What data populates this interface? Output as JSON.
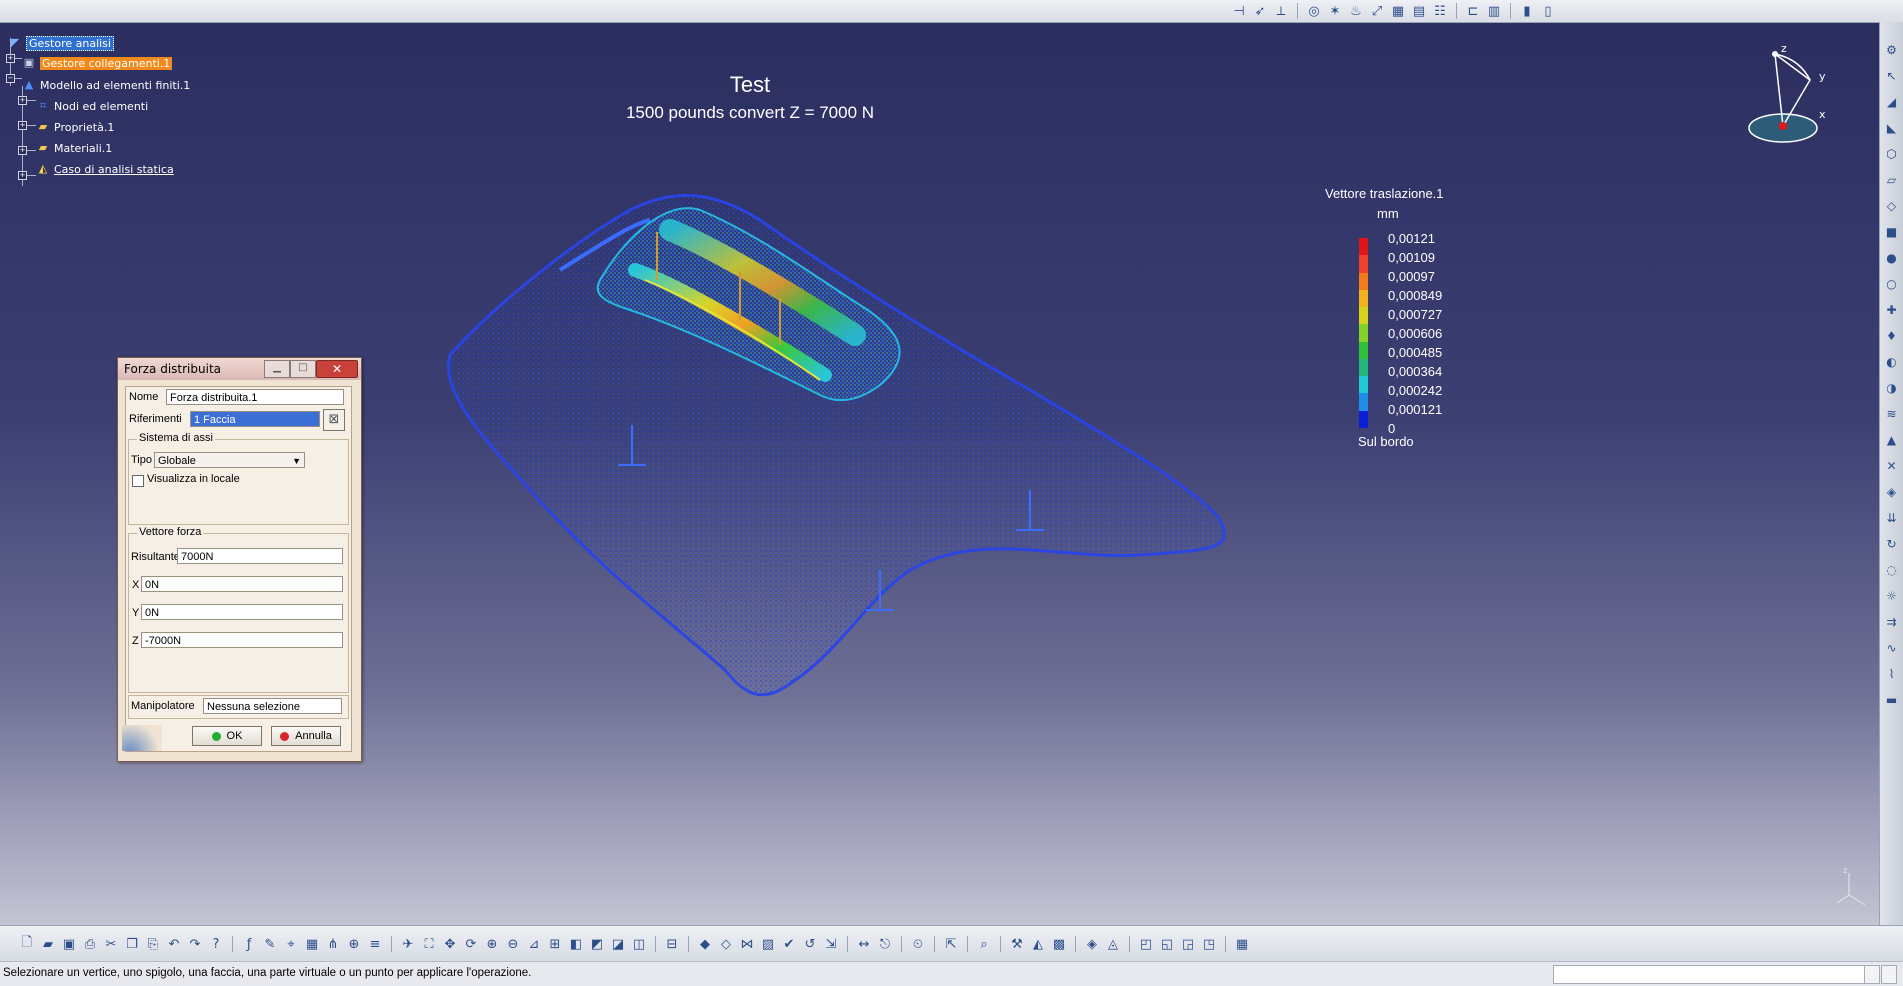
{
  "tree": {
    "items": [
      {
        "label": "Gestore analisi",
        "icon": "analysis-manager-icon"
      },
      {
        "label": "Gestore collegamenti.1",
        "icon": "links-manager-icon"
      },
      {
        "label": "Modello ad elementi finiti.1",
        "icon": "fem-model-icon"
      },
      {
        "label": "Nodi ed elementi",
        "icon": "nodes-elements-icon"
      },
      {
        "label": "Proprietà.1",
        "icon": "folder-icon"
      },
      {
        "label": "Materiali.1",
        "icon": "folder-icon"
      },
      {
        "label": "Caso di analisi statica",
        "icon": "static-case-icon"
      }
    ]
  },
  "viewer": {
    "title": "Test",
    "subtitle": "1500 pounds convert Z = 7000 N"
  },
  "legend": {
    "title": "Vettore traslazione.1",
    "unit": "mm",
    "values": [
      "0,00121",
      "0,00109",
      "0,00097",
      "0,000849",
      "0,000727",
      "0,000606",
      "0,000485",
      "0,000364",
      "0,000242",
      "0,000121",
      "0"
    ],
    "colors": [
      "#e0151a",
      "#f0402a",
      "#f57a1c",
      "#f3b11b",
      "#d7d21b",
      "#84d22a",
      "#2dc23a",
      "#23b77c",
      "#22c9d5",
      "#1e8ee8",
      "#0a1ed8"
    ],
    "footer": "Sul bordo"
  },
  "compass": {
    "axis_z": "z",
    "axis_y": "y",
    "axis_x": "x"
  },
  "dialog": {
    "title": "Forza distribuita",
    "name_label": "Nome",
    "name_value": "Forza distribuita.1",
    "refs_label": "Riferimenti",
    "refs_value": "1 Faccia",
    "axis_group": "Sistema di assi",
    "type_label": "Tipo",
    "type_value": "Globale",
    "local_label": "Visualizza in locale",
    "force_group": "Vettore forza",
    "result_label": "Risultante",
    "result_value": "7000N",
    "x_label": "X",
    "x_value": "0N",
    "y_label": "Y",
    "y_value": "0N",
    "z_label": "Z",
    "z_value": "-7000N",
    "manip_label": "Manipolatore",
    "manip_value": "Nessuna selezione",
    "ok": "OK",
    "cancel": "Annulla"
  },
  "status": {
    "message": "Selezionare un vertice, uno spigolo, una faccia, una parte virtuale o un punto per applicare l'operazione."
  }
}
